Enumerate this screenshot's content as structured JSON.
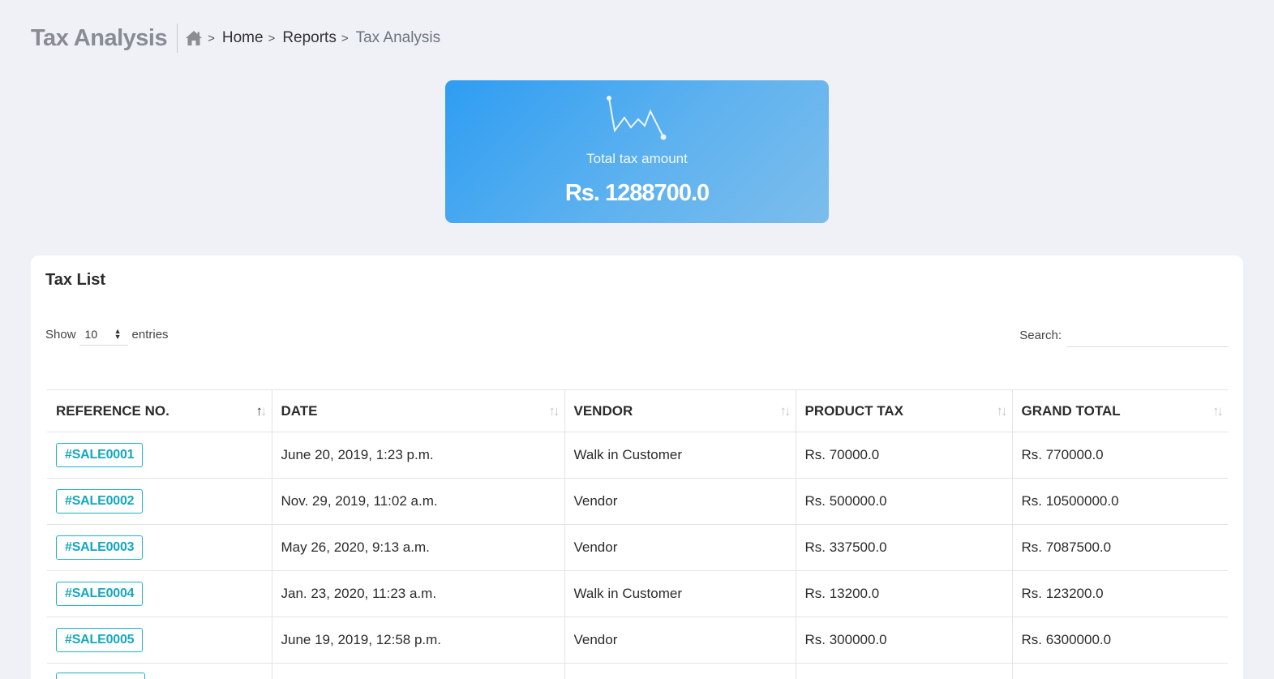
{
  "header": {
    "title": "Tax Analysis",
    "breadcrumb": [
      "Home",
      "Reports"
    ],
    "breadcrumb_current": "Tax Analysis",
    "separator": ">"
  },
  "stat": {
    "icon": "line-chart-icon",
    "label": "Total tax amount",
    "value": "Rs. 1288700.0"
  },
  "panel": {
    "title": "Tax List",
    "show_label": "Show",
    "entries_value": "10",
    "entries_label": "entries",
    "search_label": "Search:",
    "search_value": ""
  },
  "table": {
    "columns": [
      "REFERENCE NO.",
      "DATE",
      "VENDOR",
      "PRODUCT TAX",
      "GRAND TOTAL"
    ],
    "rows": [
      {
        "ref": "#SALE0001",
        "date": "June 20, 2019, 1:23 p.m.",
        "vendor": "Walk in Customer",
        "tax": "Rs. 70000.0",
        "total": "Rs. 770000.0"
      },
      {
        "ref": "#SALE0002",
        "date": "Nov. 29, 2019, 11:02 a.m.",
        "vendor": "Vendor",
        "tax": "Rs. 500000.0",
        "total": "Rs. 10500000.0"
      },
      {
        "ref": "#SALE0003",
        "date": "May 26, 2020, 9:13 a.m.",
        "vendor": "Vendor",
        "tax": "Rs. 337500.0",
        "total": "Rs. 7087500.0"
      },
      {
        "ref": "#SALE0004",
        "date": "Jan. 23, 2020, 11:23 a.m.",
        "vendor": "Walk in Customer",
        "tax": "Rs. 13200.0",
        "total": "Rs. 123200.0"
      },
      {
        "ref": "#SALE0005",
        "date": "June 19, 2019, 12:58 p.m.",
        "vendor": "Vendor",
        "tax": "Rs. 300000.0",
        "total": "Rs. 6300000.0"
      },
      {
        "ref": "",
        "date": "",
        "vendor": "",
        "tax": "",
        "total": ""
      }
    ]
  },
  "colors": {
    "badge": "#14a8be",
    "card_gradient_start": "#2e9df2",
    "card_gradient_end": "#7cbdec",
    "background": "#f0f1f6"
  }
}
